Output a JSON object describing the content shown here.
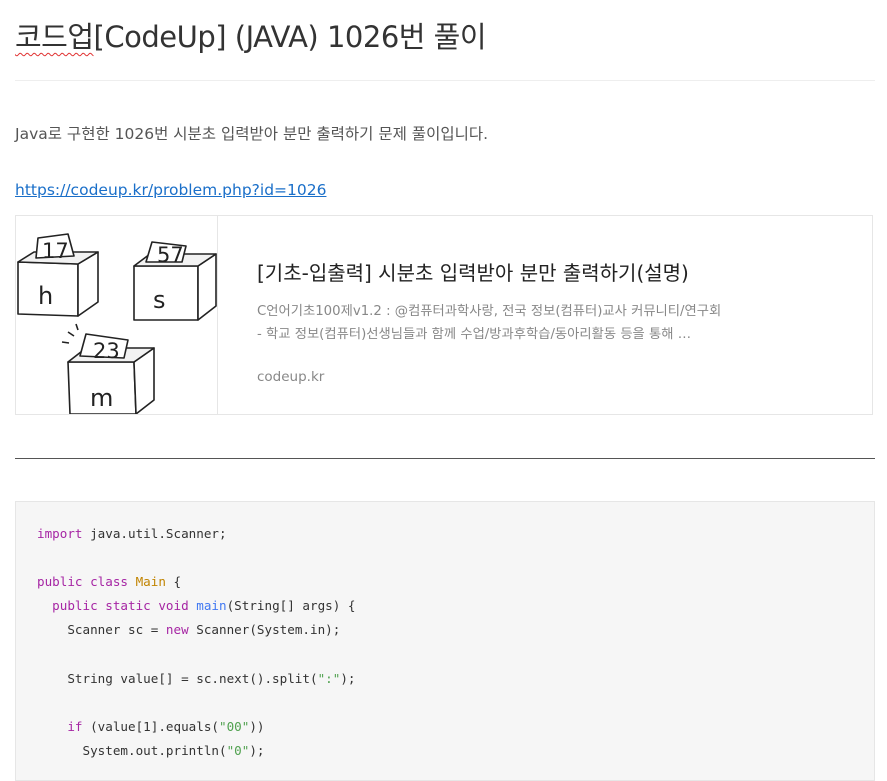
{
  "post": {
    "title_prefix": "코드업",
    "title_rest": "[CodeUp] (JAVA) 1026번 풀이",
    "intro": "Java로 구현한 1026번 시분초 입력받아 분만 출력하기 문제 풀이입니다.",
    "link_text": "https://codeup.kr/problem.php?id=1026"
  },
  "card": {
    "title": "[기초-입출력] 시분초 입력받아 분만 출력하기(설명)",
    "description": "C언어기초100제v1.2 : @컴퓨터과학사랑, 전국 정보(컴퓨터)교사 커뮤니티/연구회 - 학교 정보(컴퓨터)선생님들과 함께 수업/방과후학습/동아리활동 등을 통해 …",
    "domain": "codeup.kr",
    "thumbnail": {
      "boxes": [
        {
          "number": "17",
          "letter": "h"
        },
        {
          "number": "57",
          "letter": "s"
        },
        {
          "number": "23",
          "letter": "m"
        }
      ]
    }
  },
  "code": {
    "l1_kw": "import",
    "l1_rest": " java.util.Scanner;",
    "l2_kw": "public class",
    "l2_cls": "Main",
    "l2_rest": " {",
    "l3_kw": "public static void",
    "l3_fn": "main",
    "l3_rest": "(String[] args) {",
    "l4_a": "Scanner sc = ",
    "l4_kw": "new",
    "l4_b": " Scanner(System.in);",
    "l5_a": "String value[] = sc.next().split(",
    "l5_str": "\":\"",
    "l5_b": ");",
    "l6_kw": "if",
    "l6_a": " (value[1].equals(",
    "l6_str": "\"00\"",
    "l6_b": "))",
    "l7_a": "System.out.println(",
    "l7_str": "\"0\"",
    "l7_b": ");"
  }
}
